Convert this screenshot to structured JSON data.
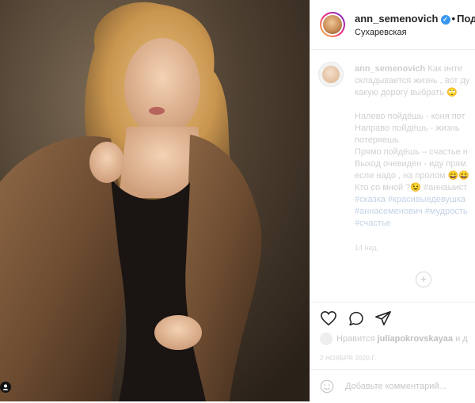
{
  "post": {
    "username": "ann_semenovich",
    "follow_label": "Подпис",
    "location": "Сухаревская",
    "caption_user": "ann_semenovich",
    "caption_lines": [
      "Как инте",
      "складывается жизнь , вот ду",
      "какую дорогу выбрать 🙄",
      "",
      "Налево пойдёшь - коня пот",
      "Направо пойдёшь - жизнь",
      "потеряешь.",
      "Прямо пойдёшь – счастье н",
      "Выход очевиден - иду прям",
      "если надо , на пролом 😄😄",
      "Кто со мной ?😉 #аннаыист"
    ],
    "hashtag_lines": [
      "#сказка #красивыедевушка",
      "#аннасеменович #мудрость",
      "#счастье"
    ],
    "time_ago": "14 нед.",
    "liked_by_prefix": "Нравится",
    "liked_by_user": "juliapokrovskayaa",
    "liked_by_suffix": "и д",
    "date": "2 НОЯБРЯ 2020 Г.",
    "comment_placeholder": "Добавьте комментарий..."
  },
  "icons": {
    "like": "heart-icon",
    "comment": "comment-icon",
    "share": "share-icon",
    "load_more": "plus-circle-icon",
    "emoji": "smile-icon",
    "verified": "verified-badge-icon"
  },
  "colors": {
    "verified": "#3897f0",
    "hashtag": "#c4d3e6"
  }
}
